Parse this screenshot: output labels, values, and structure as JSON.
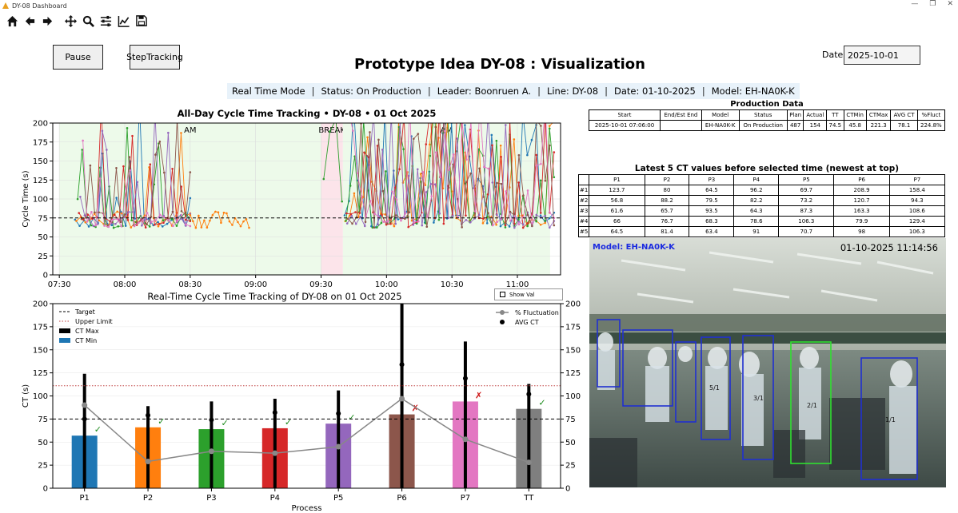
{
  "window": {
    "title": "DY-08 Dashboard"
  },
  "toolbar": {
    "items": [
      "home-icon",
      "back-icon",
      "forward-icon",
      "pan-icon",
      "zoom-icon",
      "configure-subplots-icon",
      "edit-axis-icon",
      "save-icon"
    ]
  },
  "controls": {
    "pause_label": "Pause",
    "step_label": "StepTracking",
    "date_label": "Date",
    "date_value": "2025-10-01",
    "show_val_label": "Show Val"
  },
  "header": {
    "title": "Prototype Idea DY-08 : Visualization"
  },
  "status": {
    "mode": "Real Time Mode",
    "status": "Status: On Production",
    "leader": "Leader: Boonruen A.",
    "line": "Line: DY-08",
    "date": "Date: 01-10-2025",
    "model": "Model: EH-NA0K-K"
  },
  "production": {
    "title": "Production Data",
    "headers": [
      "Start",
      "End/Est End",
      "Model",
      "Status",
      "Plan",
      "Actual",
      "TT",
      "CTMin",
      "CTMax",
      "AVG CT",
      "%Fluct"
    ],
    "row": [
      "2025-10-01 07:06:00",
      "",
      "EH-NA0K-K",
      "On Production",
      "487",
      "154",
      "74.5",
      "45.8",
      "221.3",
      "78.1",
      "224.8%"
    ]
  },
  "latest": {
    "title": "Latest 5 CT values before selected time (newest at top)",
    "headers": [
      "",
      "P1",
      "P2",
      "P3",
      "P4",
      "P5",
      "P6",
      "P7"
    ],
    "rows": [
      [
        "#1",
        "123.7",
        "80",
        "64.5",
        "96.2",
        "69.7",
        "208.9",
        "158.4"
      ],
      [
        "#2",
        "56.8",
        "88.2",
        "79.5",
        "82.2",
        "73.2",
        "120.7",
        "94.3"
      ],
      [
        "#3",
        "61.6",
        "65.7",
        "93.5",
        "64.3",
        "87.3",
        "163.3",
        "108.6"
      ],
      [
        "#4",
        "66",
        "76.7",
        "68.3",
        "78.6",
        "106.3",
        "79.9",
        "129.4"
      ],
      [
        "#5",
        "64.5",
        "81.4",
        "63.4",
        "91",
        "70.7",
        "98",
        "106.3"
      ]
    ]
  },
  "camera": {
    "model_text": "Model: EH-NA0K-K",
    "timestamp": "01-10-2025 11:14:56",
    "box_labels": [
      "5/1",
      "3/1",
      "2/1",
      "1/1"
    ]
  },
  "chart_data": [
    {
      "type": "line",
      "title": "All-Day Cycle Time Tracking • DY-08 • 01 Oct 2025",
      "ylabel": "Cycle Time (s)",
      "xlabel": "",
      "ylim": [
        0,
        200
      ],
      "yticks": [
        0,
        25,
        50,
        75,
        100,
        125,
        150,
        175,
        200
      ],
      "xlim": [
        7.45,
        11.33
      ],
      "xticks": [
        {
          "v": 7.5,
          "label": "07:30"
        },
        {
          "v": 8.0,
          "label": "08:00"
        },
        {
          "v": 8.5,
          "label": "08:30"
        },
        {
          "v": 9.0,
          "label": "09:00"
        },
        {
          "v": 9.5,
          "label": "09:30"
        },
        {
          "v": 10.0,
          "label": "10:00"
        },
        {
          "v": 10.5,
          "label": "10:30"
        },
        {
          "v": 11.0,
          "label": "11:00"
        }
      ],
      "target": 75,
      "regions": [
        {
          "label": "AM",
          "start": 7.5,
          "end": 9.5,
          "color": "#edfaea"
        },
        {
          "label": "BREAK",
          "start": 9.5,
          "end": 9.667,
          "color": "#fce4ea"
        },
        {
          "label": "AM",
          "start": 9.667,
          "end": 11.25,
          "color": "#edfaea"
        }
      ],
      "grid": true
    },
    {
      "type": "bar",
      "title": "Real-Time Cycle Time Tracking of DY-08 on 01 Oct 2025",
      "xlabel": "Process",
      "ylabel": "CT (s)",
      "ylim": [
        0,
        200
      ],
      "yticks": [
        0,
        25,
        50,
        75,
        100,
        125,
        150,
        175,
        200
      ],
      "categories": [
        "P1",
        "P2",
        "P3",
        "P4",
        "P5",
        "P6",
        "P7",
        "TT"
      ],
      "ct_min": [
        57,
        66,
        64,
        65,
        70,
        80,
        94,
        86
      ],
      "ct_max": [
        124,
        89,
        94,
        97,
        106,
        209,
        159,
        113
      ],
      "avg_ct": [
        75,
        79,
        74,
        82,
        81,
        134,
        119,
        102
      ],
      "fluctuation": [
        90,
        29,
        40,
        38,
        45,
        97,
        53,
        28
      ],
      "status": [
        "ok",
        "ok",
        "ok",
        "ok",
        "ok",
        "ng",
        "ng",
        "ok"
      ],
      "bar_colors": [
        "#1f77b4",
        "#ff7f0e",
        "#2ca02c",
        "#d62728",
        "#9467bd",
        "#8c564b",
        "#e377c2",
        "#7f7f7f"
      ],
      "target": 75,
      "upper_limit": 111,
      "legend_left": [
        {
          "name": "Target",
          "style": "dashed"
        },
        {
          "name": "Upper Limit",
          "style": "dotted-red"
        },
        {
          "name": "CT Max",
          "style": "black"
        },
        {
          "name": "CT Min",
          "style": "blue"
        }
      ],
      "legend_right": [
        {
          "name": "% Fluctuation"
        },
        {
          "name": "AVG CT"
        }
      ],
      "legend_placement": "top-left / top-right",
      "grid": true
    }
  ]
}
